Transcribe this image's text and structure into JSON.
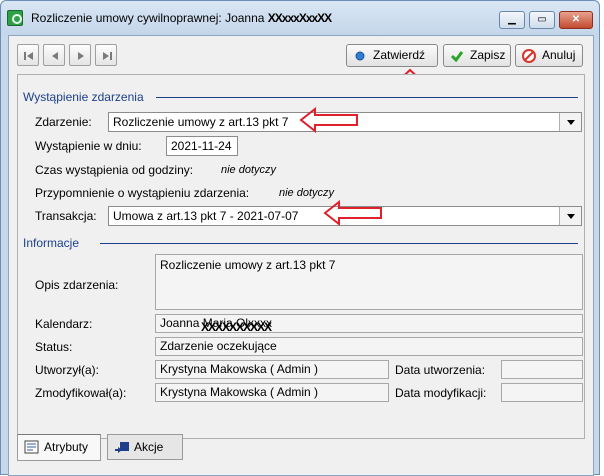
{
  "window": {
    "title_prefix": "Rozliczenie umowy cywilnoprawnej: Joanna",
    "title_redacted": "XXxxxXxxXX",
    "min_label": "▁",
    "max_label": "▭",
    "close_label": "✕"
  },
  "toolbar": {
    "confirm_label": "Zatwierdź",
    "save_label": "Zapisz",
    "cancel_label": "Anuluj"
  },
  "event_section": {
    "heading": "Wystąpienie zdarzenia",
    "event_label": "Zdarzenie:",
    "event_value": "Rozliczenie umowy z art.13 pkt 7",
    "date_label": "Wystąpienie w dniu:",
    "date_value": "2021-11-24",
    "time_label": "Czas wystąpienia od godziny:",
    "time_value": "nie dotyczy",
    "reminder_label": "Przypomnienie o wystąpieniu zdarzenia:",
    "reminder_value": "nie dotyczy",
    "transaction_label": "Transakcja:",
    "transaction_value": "Umowa z art.13 pkt 7  -  2021-07-07"
  },
  "info_section": {
    "heading": "Informacje",
    "description_label": "Opis zdarzenia:",
    "description_value": "Rozliczenie umowy z art.13 pkt 7",
    "calendar_label": "Kalendarz:",
    "calendar_value": "Joanna Maria Olxxxx",
    "calendar_redacted": "XXXXXXXXXX",
    "status_label": "Status:",
    "status_value": "Zdarzenie oczekujące",
    "created_by_label": "Utworzył(a):",
    "created_by_value": "Krystyna Makowska ( Admin )",
    "created_date_label": "Data utworzenia:",
    "created_date_value": "",
    "modified_by_label": "Zmodyfikował(a):",
    "modified_by_value": "Krystyna Makowska ( Admin )",
    "modified_date_label": "Data modyfikacji:",
    "modified_date_value": ""
  },
  "tabs": [
    {
      "label": "Atrybuty",
      "active": true
    },
    {
      "label": "Akcje",
      "active": false
    }
  ],
  "colors": {
    "section_heading": "#1c3f8c",
    "annotation_arrow": "#e0202a",
    "accent_confirm": "#2f7fd8",
    "save_check": "#2aa32a",
    "cancel_icon": "#d8342a"
  }
}
